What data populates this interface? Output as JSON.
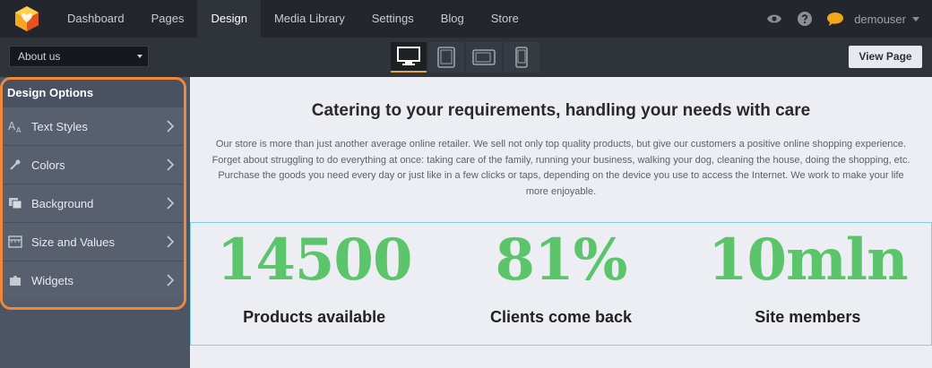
{
  "topnav": {
    "items": [
      {
        "label": "Dashboard",
        "active": false
      },
      {
        "label": "Pages",
        "active": false
      },
      {
        "label": "Design",
        "active": true
      },
      {
        "label": "Media Library",
        "active": false
      },
      {
        "label": "Settings",
        "active": false
      },
      {
        "label": "Blog",
        "active": false
      },
      {
        "label": "Store",
        "active": false
      }
    ],
    "username": "demouser",
    "icons": [
      "eye-icon",
      "help-icon",
      "chat-icon"
    ]
  },
  "toolbar": {
    "page_select": "About us",
    "devices": [
      "desktop-icon",
      "tablet-portrait-icon",
      "tablet-landscape-icon",
      "phone-icon"
    ],
    "active_device": "desktop-icon",
    "view_button": "View Page"
  },
  "sidebar": {
    "title": "Design Options",
    "items": [
      {
        "label": "Text Styles",
        "icon": "text-styles-icon"
      },
      {
        "label": "Colors",
        "icon": "colors-icon"
      },
      {
        "label": "Background",
        "icon": "background-icon"
      },
      {
        "label": "Size and Values",
        "icon": "size-values-icon"
      },
      {
        "label": "Widgets",
        "icon": "widgets-icon"
      }
    ]
  },
  "content": {
    "heading": "Catering to your requirements, handling your needs with care",
    "paragraph": "Our store is more than just another average online retailer. We sell not only top quality products, but give our customers a positive online shopping experience. Forget about struggling to do everything at once: taking care of the family, running your business, walking your dog, cleaning the house, doing the shopping, etc. Purchase the goods you need every day or just like in a few clicks or taps, depending on the device you use to access the Internet. We work to make your life more enjoyable.",
    "stats": [
      {
        "number": "14500",
        "label": "Products available"
      },
      {
        "number": "81%",
        "label": "Clients come back"
      },
      {
        "number": "10mln",
        "label": "Site members"
      }
    ]
  },
  "colors": {
    "accent_orange": "#f0883a",
    "stat_green": "#5cc46a",
    "selection_cyan": "#79d3e0"
  }
}
